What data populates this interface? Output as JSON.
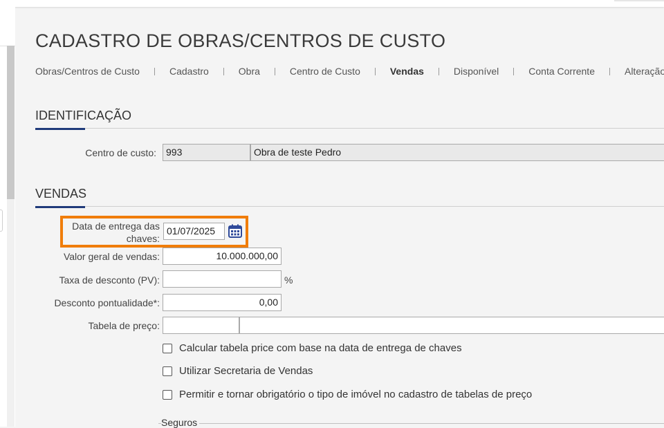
{
  "page": {
    "title": "CADASTRO DE OBRAS/CENTROS DE CUSTO"
  },
  "tabs": [
    {
      "label": "Obras/Centros de Custo"
    },
    {
      "label": "Cadastro"
    },
    {
      "label": "Obra"
    },
    {
      "label": "Centro de Custo"
    },
    {
      "label": "Vendas",
      "active": true
    },
    {
      "label": "Disponível"
    },
    {
      "label": "Conta Corrente"
    },
    {
      "label": "Alteração"
    }
  ],
  "identificacao": {
    "title": "IDENTIFICAÇÃO",
    "centro_label": "Centro de custo",
    "centro_code": "993",
    "centro_name": "Obra de teste Pedro"
  },
  "vendas": {
    "title": "VENDAS",
    "data_entrega_label_1": "Data de entrega das",
    "data_entrega_label_2": "chaves",
    "data_entrega_value": "01/07/2025",
    "valor_geral_label": "Valor geral de vendas",
    "valor_geral_value": "10.000.000,00",
    "taxa_desconto_label": "Taxa de desconto (PV)",
    "taxa_desconto_value": "",
    "percent_symbol": "%",
    "desconto_pontualidade_label": "Desconto pontualidade*",
    "desconto_pontualidade_value": "0,00",
    "tabela_preco_label": "Tabela de preço",
    "tabela_preco_code": "",
    "tabela_preco_name": ""
  },
  "checkboxes": [
    {
      "label": "Calcular tabela price com base na data de entrega de chaves",
      "checked": false
    },
    {
      "label": "Utilizar Secretaria de Vendas",
      "checked": false
    },
    {
      "label": "Permitir e tornar obrigatório o tipo de imóvel no cadastro de tabelas de preço",
      "checked": false
    }
  ],
  "seguros": {
    "legend": "Seguros"
  },
  "colors": {
    "accent": "#1f3a7a",
    "highlight": "#f07d0a",
    "calendar_icon": "#2f4a9a"
  },
  "icons": {
    "calendar": "calendar-icon"
  }
}
